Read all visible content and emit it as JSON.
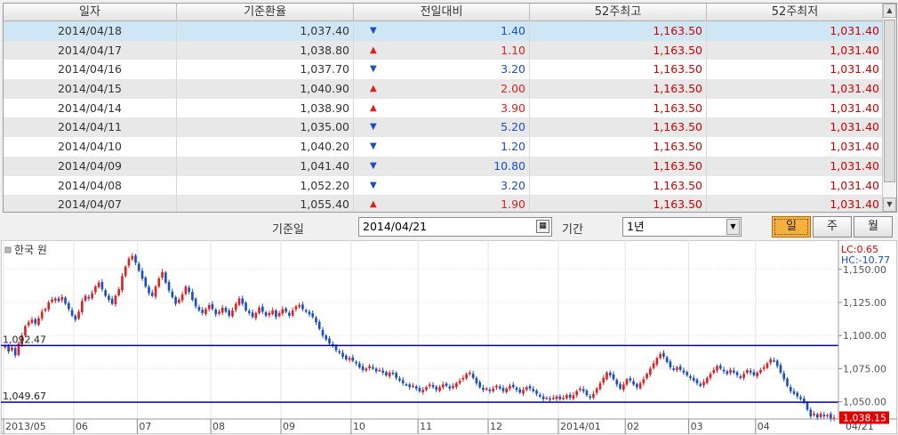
{
  "table": {
    "headers": [
      "일자",
      "기준환율",
      "전일대비",
      "52주최고",
      "52주최저"
    ],
    "rows": [
      {
        "date": "2014/04/18",
        "rate": "1,037.40",
        "dir": "down",
        "change": "1.40",
        "high": "1,163.50",
        "low": "1,031.40"
      },
      {
        "date": "2014/04/17",
        "rate": "1,038.80",
        "dir": "up",
        "change": "1.10",
        "high": "1,163.50",
        "low": "1,031.40"
      },
      {
        "date": "2014/04/16",
        "rate": "1,037.70",
        "dir": "down",
        "change": "3.20",
        "high": "1,163.50",
        "low": "1,031.40"
      },
      {
        "date": "2014/04/15",
        "rate": "1,040.90",
        "dir": "up",
        "change": "2.00",
        "high": "1,163.50",
        "low": "1,031.40"
      },
      {
        "date": "2014/04/14",
        "rate": "1,038.90",
        "dir": "up",
        "change": "3.90",
        "high": "1,163.50",
        "low": "1,031.40"
      },
      {
        "date": "2014/04/11",
        "rate": "1,035.00",
        "dir": "down",
        "change": "5.20",
        "high": "1,163.50",
        "low": "1,031.40"
      },
      {
        "date": "2014/04/10",
        "rate": "1,040.20",
        "dir": "down",
        "change": "1.20",
        "high": "1,163.50",
        "low": "1,031.40"
      },
      {
        "date": "2014/04/09",
        "rate": "1,041.40",
        "dir": "down",
        "change": "10.80",
        "high": "1,163.50",
        "low": "1,031.40"
      },
      {
        "date": "2014/04/08",
        "rate": "1,052.20",
        "dir": "down",
        "change": "3.20",
        "high": "1,163.50",
        "low": "1,031.40"
      },
      {
        "date": "2014/04/07",
        "rate": "1,055.40",
        "dir": "up",
        "change": "1.90",
        "high": "1,163.50",
        "low": "1,031.40"
      }
    ],
    "selected_index": 0
  },
  "controls": {
    "base_date_label": "기준일",
    "base_date_value": "2014/04/21",
    "period_label": "기간",
    "period_value": "1년",
    "buttons": [
      "일",
      "주",
      "월"
    ],
    "active_button": "일"
  },
  "colors": {
    "up": "#e02020",
    "down": "#1a4ec6",
    "hline": "#0000c8",
    "current_price_box": "#e00000"
  },
  "chart_data": {
    "type": "candlestick",
    "legend": "한국 원",
    "indicator_lc": "LC:0.65",
    "indicator_hc": "HC:-10.77",
    "ylim": [
      1037,
      1172
    ],
    "yticks": [
      1050,
      1075,
      1100,
      1125,
      1150
    ],
    "ytick_labels": [
      "1,050.00",
      "1,075.00",
      "1,100.00",
      "1,125.00",
      "1,150.00"
    ],
    "xtick_labels": [
      "2013/05",
      "06",
      "07",
      "08",
      "09",
      "10",
      "11",
      "12",
      "2014/01",
      "02",
      "03",
      "04",
      "04/21"
    ],
    "hlines": [
      {
        "value": 1092.47,
        "label": "1,092.47"
      },
      {
        "value": 1049.67,
        "label": "1,049.67"
      }
    ],
    "current_price": "1,038.15",
    "closes": [
      1092,
      1088,
      1091,
      1085,
      1094,
      1100,
      1107,
      1110,
      1112,
      1109,
      1113,
      1118,
      1120,
      1125,
      1127,
      1128,
      1126,
      1129,
      1124,
      1120,
      1115,
      1112,
      1118,
      1126,
      1130,
      1128,
      1132,
      1137,
      1140,
      1135,
      1130,
      1127,
      1124,
      1130,
      1135,
      1145,
      1152,
      1158,
      1160,
      1155,
      1149,
      1143,
      1137,
      1132,
      1130,
      1137,
      1143,
      1148,
      1140,
      1134,
      1129,
      1124,
      1127,
      1131,
      1137,
      1133,
      1127,
      1122,
      1119,
      1117,
      1120,
      1123,
      1120,
      1116,
      1118,
      1121,
      1118,
      1115,
      1119,
      1124,
      1128,
      1124,
      1119,
      1117,
      1114,
      1117,
      1121,
      1118,
      1115,
      1117,
      1119,
      1114,
      1117,
      1120,
      1118,
      1115,
      1119,
      1122,
      1123,
      1120,
      1118,
      1116,
      1114,
      1110,
      1105,
      1100,
      1097,
      1094,
      1092,
      1089,
      1087,
      1084,
      1082,
      1083,
      1081,
      1079,
      1076,
      1074,
      1075,
      1077,
      1075,
      1073,
      1074,
      1072,
      1070,
      1072,
      1071,
      1068,
      1066,
      1064,
      1063,
      1061,
      1062,
      1060,
      1058,
      1059,
      1061,
      1063,
      1061,
      1059,
      1061,
      1063,
      1062,
      1060,
      1062,
      1064,
      1066,
      1068,
      1071,
      1072,
      1068,
      1064,
      1061,
      1059,
      1060,
      1058,
      1060,
      1062,
      1060,
      1058,
      1060,
      1062,
      1061,
      1059,
      1057,
      1059,
      1061,
      1060,
      1058,
      1056,
      1054,
      1052,
      1053,
      1052,
      1053,
      1054,
      1052,
      1053,
      1055,
      1053,
      1055,
      1058,
      1060,
      1058,
      1055,
      1053,
      1056,
      1060,
      1064,
      1068,
      1072,
      1070,
      1067,
      1063,
      1060,
      1063,
      1067,
      1066,
      1063,
      1061,
      1064,
      1067,
      1071,
      1075,
      1079,
      1083,
      1086,
      1084,
      1080,
      1076,
      1074,
      1076,
      1074,
      1072,
      1070,
      1068,
      1066,
      1064,
      1062,
      1065,
      1068,
      1071,
      1074,
      1077,
      1075,
      1073,
      1071,
      1074,
      1072,
      1070,
      1068,
      1071,
      1074,
      1072,
      1070,
      1072,
      1074,
      1076,
      1079,
      1082,
      1081,
      1077,
      1072,
      1067,
      1062,
      1058,
      1056,
      1054,
      1052,
      1050,
      1044,
      1039,
      1041,
      1038,
      1041,
      1039,
      1040,
      1037,
      1038
    ]
  }
}
